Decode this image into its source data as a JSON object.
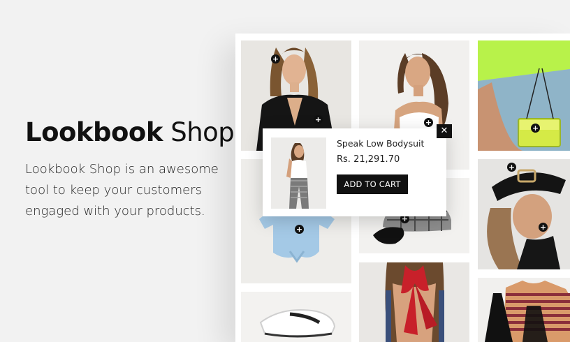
{
  "hero": {
    "title_bold": "Lookbook",
    "title_light": " Shop",
    "description": "Lookbook Shop is an awesome tool to keep your customers engaged with your products."
  },
  "gallery": {
    "tiles": [
      {
        "name": "tile-black-cardigan-model"
      },
      {
        "name": "tile-white-bodysuit-model"
      },
      {
        "name": "tile-neon-clear-bag"
      },
      {
        "name": "tile-blue-tshirt"
      },
      {
        "name": "tile-plaid-cap"
      },
      {
        "name": "tile-black-visor-model"
      },
      {
        "name": "tile-sneakers"
      },
      {
        "name": "tile-red-scarf"
      },
      {
        "name": "tile-striped-tee-overalls"
      }
    ],
    "hotspot_symbol": "+"
  },
  "popup": {
    "product_name": "Speak Low Bodysuit",
    "price": "Rs. 21,291.70",
    "add_to_cart_label": "ADD TO CART",
    "close_symbol": "✕"
  },
  "colors": {
    "background": "#f2f2f2",
    "panel": "#ffffff",
    "button": "#111111",
    "button_text": "#ffffff"
  }
}
